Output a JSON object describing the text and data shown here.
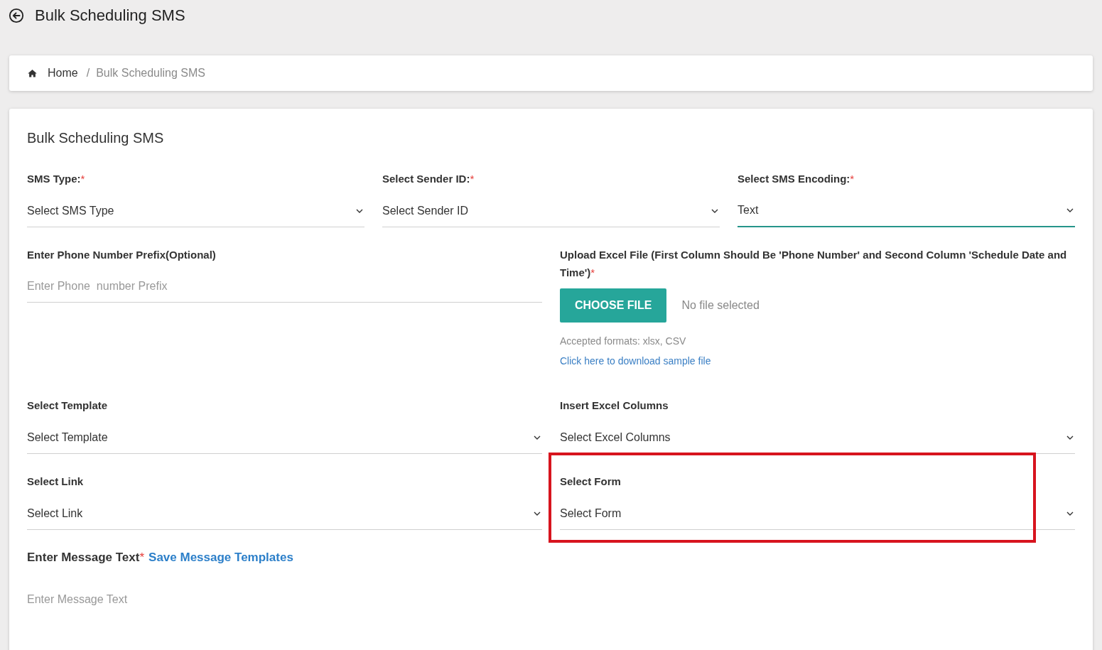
{
  "header": {
    "title": "Bulk Scheduling SMS"
  },
  "breadcrumb": [
    {
      "label": "Home",
      "kind": "home"
    },
    {
      "label": "/",
      "kind": "separator"
    },
    {
      "label": "Bulk Scheduling SMS",
      "kind": "current"
    }
  ],
  "form": {
    "title": "Bulk Scheduling SMS",
    "rows": [
      {
        "fields": [
          {
            "kind": "select",
            "label": "SMS Type:",
            "required_mark": "*",
            "placeholder": "Select SMS Type",
            "focused": false,
            "highlighted": false
          },
          {
            "kind": "select",
            "label": "Select Sender ID:",
            "required_mark": "*",
            "placeholder": "Select Sender ID",
            "focused": false,
            "highlighted": false
          },
          {
            "kind": "select",
            "label": "Select SMS Encoding:",
            "required_mark": "*",
            "value": "Text",
            "focused": true,
            "highlighted": false
          }
        ]
      },
      {
        "fields": [
          {
            "kind": "text",
            "label": "Enter Phone Number Prefix(Optional)",
            "placeholder": "Enter Phone  number Prefix"
          },
          {
            "kind": "file",
            "label": "Upload Excel File (First Column Should Be 'Phone Number' and Second Column 'Schedule Date and Time')",
            "required_mark": "*",
            "button": "CHOOSE FILE",
            "status": "No file selected",
            "hint": "Accepted formats: xlsx, CSV",
            "link": "Click here to download sample file"
          }
        ]
      },
      {
        "fields": [
          {
            "kind": "select",
            "label": "Select Template",
            "placeholder": "Select Template",
            "focused": false,
            "highlighted": false
          },
          {
            "kind": "select",
            "label": "Insert Excel Columns",
            "placeholder": "Select Excel Columns",
            "focused": false,
            "highlighted": false
          }
        ]
      },
      {
        "fields": [
          {
            "kind": "select",
            "label": "Select Link",
            "placeholder": "Select Link",
            "focused": false,
            "highlighted": false
          },
          {
            "kind": "select",
            "label": "Select Form",
            "placeholder": "Select Form",
            "focused": false,
            "highlighted": true
          }
        ]
      },
      {
        "fields": [
          {
            "kind": "message",
            "label": "Enter Message Text",
            "required_mark": "*",
            "link": "Save Message Templates",
            "placeholder": "Enter Message Text"
          }
        ]
      }
    ]
  }
}
